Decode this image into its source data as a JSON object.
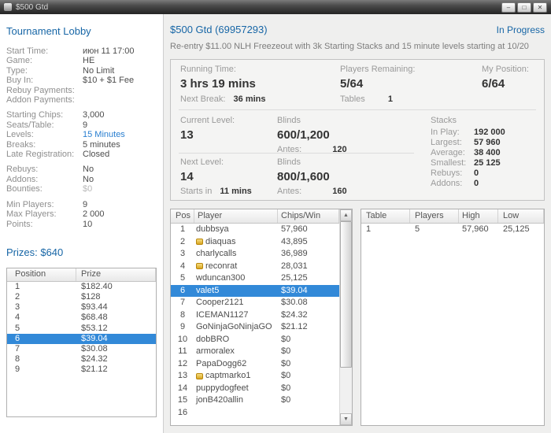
{
  "titlebar": {
    "title": "$500 Gtd",
    "minimize_glyph": "–",
    "maximize_glyph": "□",
    "close_glyph": "✕"
  },
  "icons": {
    "scroll_up": "▲",
    "scroll_down": "▼",
    "gold_badge": "gold-badge"
  },
  "accent_colors": {
    "heading_blue": "#1766a6",
    "link_blue": "#2a7fd0",
    "highlight_blue": "#3289d8"
  },
  "sidebar": {
    "title": "Tournament Lobby",
    "groups": [
      [
        {
          "label": "Start Time:",
          "value": "июн 11 17:00"
        },
        {
          "label": "Game:",
          "value": "HE"
        },
        {
          "label": "Type:",
          "value": "No Limit"
        },
        {
          "label": "Buy In:",
          "value": "$10 + $1 Fee"
        },
        {
          "label": "Rebuy Payments:",
          "value": ""
        },
        {
          "label": "Addon Payments:",
          "value": ""
        }
      ],
      [
        {
          "label": "Starting Chips:",
          "value": "3,000"
        },
        {
          "label": "Seats/Table:",
          "value": "9"
        },
        {
          "label": "Levels:",
          "value": "15 Minutes",
          "link": true
        },
        {
          "label": "Breaks:",
          "value": "5 minutes"
        },
        {
          "label": "Late Registration:",
          "value": "Closed"
        }
      ],
      [
        {
          "label": "Rebuys:",
          "value": "No"
        },
        {
          "label": "Addons:",
          "value": "No"
        },
        {
          "label": "Bounties:",
          "value": "$0",
          "muted": true
        }
      ],
      [
        {
          "label": "Min Players:",
          "value": "9"
        },
        {
          "label": "Max Players:",
          "value": "2 000"
        },
        {
          "label": "Points:",
          "value": "10"
        }
      ]
    ],
    "prizes_title": "Prizes: $640",
    "prize_table": {
      "headers": [
        "Position",
        "Prize"
      ],
      "rows": [
        {
          "position": "1",
          "prize": "$182.40"
        },
        {
          "position": "2",
          "prize": "$128"
        },
        {
          "position": "3",
          "prize": "$93.44"
        },
        {
          "position": "4",
          "prize": "$68.48"
        },
        {
          "position": "5",
          "prize": "$53.12"
        },
        {
          "position": "6",
          "prize": "$39.04",
          "highlighted": true
        },
        {
          "position": "7",
          "prize": "$30.08"
        },
        {
          "position": "8",
          "prize": "$24.32"
        },
        {
          "position": "9",
          "prize": "$21.12"
        }
      ]
    }
  },
  "main": {
    "title": "$500 Gtd (69957293)",
    "status": "In Progress",
    "description": "Re-entry $11.00 NLH Freezeout with 3k Starting Stacks and 15 minute levels starting at 10/20",
    "stats": {
      "running_time_label": "Running Time:",
      "running_time": "3 hrs 19 mins",
      "next_break_label": "Next Break:",
      "next_break": "36 mins",
      "players_remaining_label": "Players Remaining:",
      "players_remaining": "5/64",
      "tables_label": "Tables",
      "tables": "1",
      "my_position_label": "My Position:",
      "my_position": "6/64",
      "current_level_label": "Current Level:",
      "current_level": "13",
      "blinds_label": "Blinds",
      "current_blinds": "600/1,200",
      "antes_label": "Antes:",
      "current_antes": "120",
      "next_level_label": "Next Level:",
      "next_level": "14",
      "next_blinds": "800/1,600",
      "next_antes": "160",
      "starts_in_label": "Starts in",
      "starts_in": "11 mins",
      "stacks": {
        "title": "Stacks",
        "rows": [
          {
            "label": "In Play:",
            "value": "192 000"
          },
          {
            "label": "Largest:",
            "value": "57 960"
          },
          {
            "label": "Average:",
            "value": "38 400"
          },
          {
            "label": "Smallest:",
            "value": "25 125"
          },
          {
            "label": "Rebuys:",
            "value": "0"
          },
          {
            "label": "Addons:",
            "value": "0"
          }
        ]
      }
    },
    "players_table": {
      "headers": [
        "Pos",
        "Player",
        "Chips/Win"
      ],
      "rows": [
        {
          "pos": "1",
          "player": "dubbsya",
          "chips": "57,960",
          "badge": false
        },
        {
          "pos": "2",
          "player": "diaquas",
          "chips": "43,895",
          "badge": true
        },
        {
          "pos": "3",
          "player": "charlycalls",
          "chips": "36,989",
          "badge": false
        },
        {
          "pos": "4",
          "player": "reconrat",
          "chips": "28,031",
          "badge": true
        },
        {
          "pos": "5",
          "player": "wduncan300",
          "chips": "25,125",
          "badge": false
        },
        {
          "pos": "6",
          "player": "valet5",
          "chips": "$39.04",
          "badge": false,
          "highlighted": true
        },
        {
          "pos": "7",
          "player": "Cooper2121",
          "chips": "$30.08",
          "badge": false
        },
        {
          "pos": "8",
          "player": "ICEMAN1127",
          "chips": "$24.32",
          "badge": false
        },
        {
          "pos": "9",
          "player": "GoNinjaGoNinjaGO",
          "chips": "$21.12",
          "badge": false
        },
        {
          "pos": "10",
          "player": "dobBRO",
          "chips": "$0",
          "badge": false
        },
        {
          "pos": "11",
          "player": "armoralex",
          "chips": "$0",
          "badge": false
        },
        {
          "pos": "12",
          "player": "PapaDogg62",
          "chips": "$0",
          "badge": false
        },
        {
          "pos": "13",
          "player": "captmarko1",
          "chips": "$0",
          "badge": true
        },
        {
          "pos": "14",
          "player": "puppydogfeet",
          "chips": "$0",
          "badge": false
        },
        {
          "pos": "15",
          "player": "jonB420allin",
          "chips": "$0",
          "badge": false
        },
        {
          "pos": "16",
          "player": "",
          "chips": "",
          "badge": false
        }
      ]
    },
    "tables_table": {
      "headers": [
        "Table",
        "Players",
        "High",
        "Low"
      ],
      "rows": [
        {
          "table": "1",
          "players": "5",
          "high": "57,960",
          "low": "25,125"
        }
      ]
    }
  }
}
